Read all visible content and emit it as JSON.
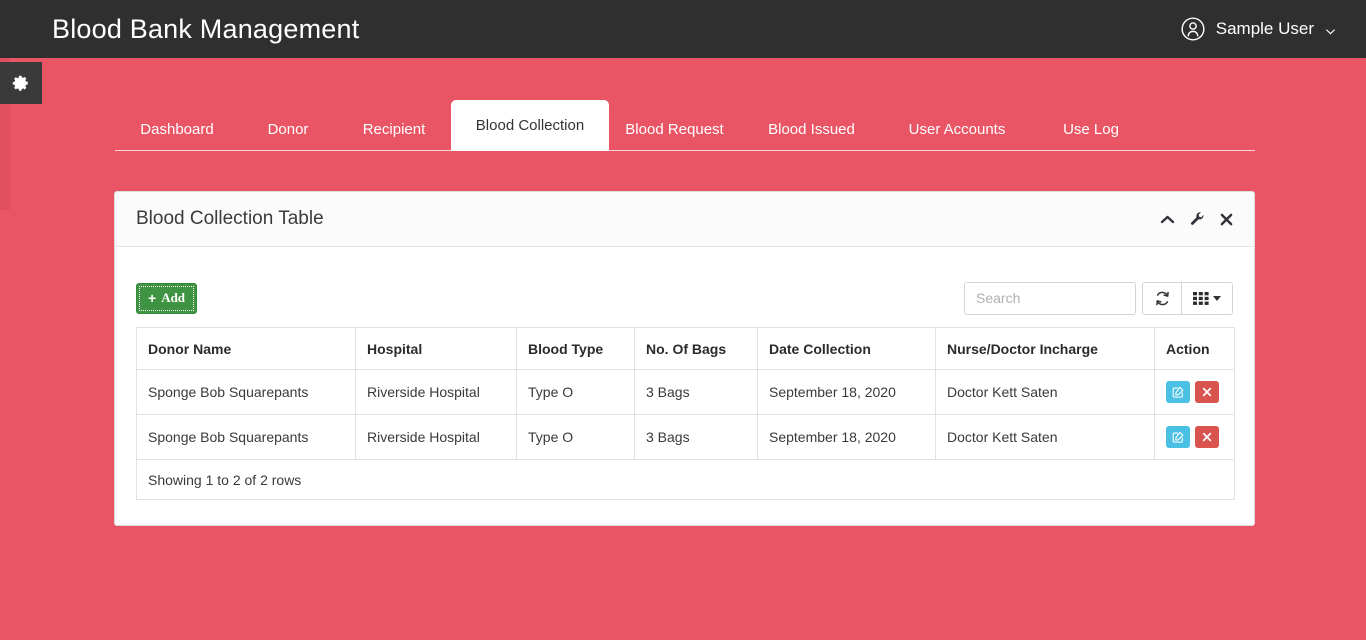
{
  "app": {
    "title": "Blood Bank Management",
    "user_name": "Sample User",
    "user_icon": "user-circle-icon",
    "caret_icon": "chevron-down-icon",
    "gear_icon": "gear-icon"
  },
  "nav": {
    "tabs": [
      {
        "label": "Dashboard",
        "active": false
      },
      {
        "label": "Donor",
        "active": false
      },
      {
        "label": "Recipient",
        "active": false
      },
      {
        "label": "Blood Collection",
        "active": true
      },
      {
        "label": "Blood Request",
        "active": false
      },
      {
        "label": "Blood Issued",
        "active": false
      },
      {
        "label": "User Accounts",
        "active": false
      },
      {
        "label": "Use Log",
        "active": false
      }
    ]
  },
  "panel": {
    "title": "Blood Collection Table",
    "tools": [
      {
        "name": "collapse-icon",
        "glyph": "chevron-up-icon"
      },
      {
        "name": "settings-icon",
        "glyph": "wrench-icon"
      },
      {
        "name": "close-icon",
        "glyph": "times-icon"
      }
    ]
  },
  "toolbar": {
    "add_label": "Add",
    "add_plus": "+",
    "search_placeholder": "Search",
    "search_value": "",
    "refresh_icon": "refresh-icon",
    "columns_icon": "grid-columns-icon"
  },
  "table": {
    "columns": [
      "Donor Name",
      "Hospital",
      "Blood Type",
      "No. Of Bags",
      "Date Collection",
      "Nurse/Doctor Incharge",
      "Action"
    ],
    "rows": [
      {
        "donor_name": "Sponge Bob Squarepants",
        "hospital": "Riverside Hospital",
        "blood_type": "Type O",
        "bags": "3 Bags",
        "date_collection": "September 18, 2020",
        "incharge": "Doctor Kett Saten"
      },
      {
        "donor_name": "Sponge Bob Squarepants",
        "hospital": "Riverside Hospital",
        "blood_type": "Type O",
        "bags": "3 Bags",
        "date_collection": "September 18, 2020",
        "incharge": "Doctor Kett Saten"
      }
    ],
    "footer_text": "Showing 1 to 2 of 2 rows"
  },
  "colors": {
    "page_background": "#ea5565",
    "topbar": "#2f2f2f",
    "add_button": "#3e9442",
    "edit_button": "#49c0e4",
    "delete_button": "#d9534f",
    "active_tab": "#ffffff"
  }
}
